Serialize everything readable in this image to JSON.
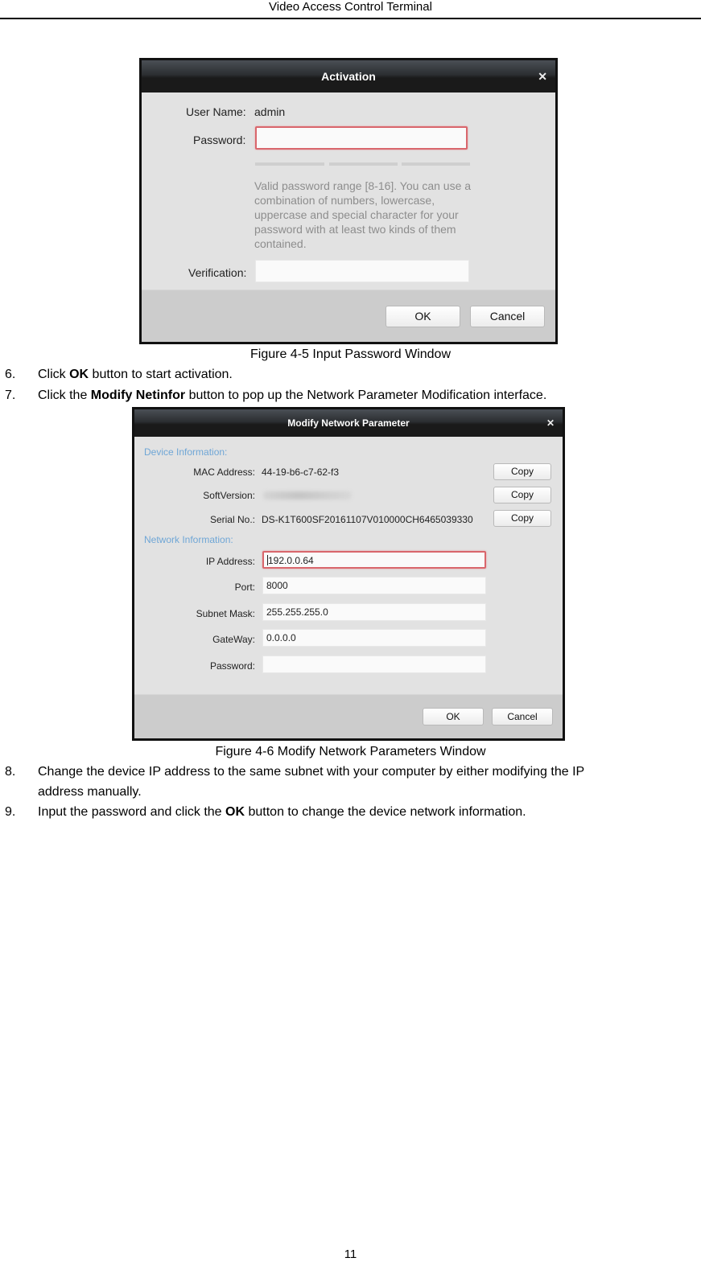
{
  "header": {
    "title": "Video Access Control Terminal"
  },
  "figure1": {
    "dialog_title": "Activation",
    "close_icon": "close-icon",
    "user_name_label": "User Name:",
    "user_name_value": "admin",
    "password_label": "Password:",
    "password_value": "",
    "password_strength_segments": 3,
    "hint": "Valid password range [8-16]. You can use a combination of numbers, lowercase, uppercase and special character for your password with at least two kinds of them contained.",
    "verification_label": "Verification:",
    "verification_value": "",
    "ok_label": "OK",
    "cancel_label": "Cancel",
    "caption": "Figure 4-5 Input Password Window"
  },
  "steps_a": [
    {
      "num": "6.",
      "pre": "Click ",
      "bold": "OK",
      "post": " button to start activation."
    },
    {
      "num": "7.",
      "pre": "Click the ",
      "bold": "Modify Netinfor",
      "post": " button to pop up the Network Parameter Modification interface."
    }
  ],
  "figure2": {
    "dialog_title": "Modify Network Parameter",
    "close_icon": "close-icon",
    "device_section": "Device Information:",
    "mac_label": "MAC Address:",
    "mac_value": "44-19-b6-c7-62-f3",
    "soft_label": "SoftVersion:",
    "soft_value_blurred": true,
    "serial_label": "Serial No.:",
    "serial_value": "DS-K1T600SF20161107V010000CH6465039330",
    "copy_label": "Copy",
    "network_section": "Network Information:",
    "ip_label": "IP Address:",
    "ip_value": "192.0.0.64",
    "port_label": "Port:",
    "port_value": "8000",
    "mask_label": "Subnet Mask:",
    "mask_value": "255.255.255.0",
    "gateway_label": "GateWay:",
    "gateway_value": "0.0.0.0",
    "password_label": "Password:",
    "password_value": "",
    "ok_label": "OK",
    "cancel_label": "Cancel",
    "caption": "Figure 4-6 Modify Network Parameters Window"
  },
  "steps_b": [
    {
      "num": "8.",
      "line1": "Change the device IP address to the same subnet with your computer by either modifying the IP",
      "line2": "address manually."
    },
    {
      "num": "9.",
      "pre": "Input the password and click the ",
      "bold": "OK",
      "post": " button to change the device network information."
    }
  ],
  "footer": {
    "page_number": "11"
  },
  "colors": {
    "focus_border": "#d9666c",
    "section_label": "#6fa6d6",
    "titlebar": "#1a1a1a",
    "dialog_bg": "#e2e2e2",
    "dialog_footer": "#cccccc"
  }
}
